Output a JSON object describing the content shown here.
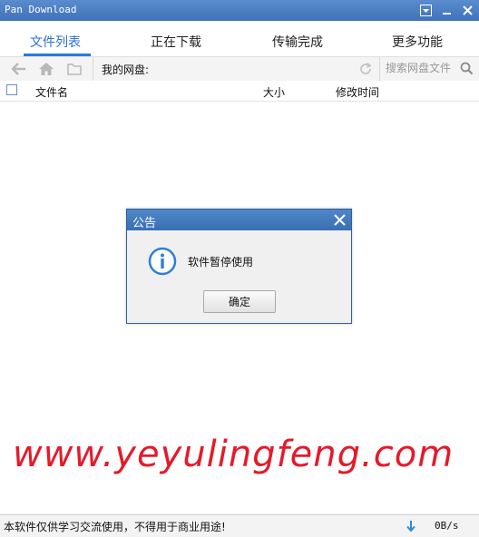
{
  "window": {
    "title": "Pan Download",
    "menu_icon": "dropdown-menu-icon",
    "minimize_icon": "minimize-icon",
    "close_icon": "close-icon"
  },
  "tabs": [
    {
      "label": "文件列表",
      "active": true
    },
    {
      "label": "正在下载",
      "active": false
    },
    {
      "label": "传输完成",
      "active": false
    },
    {
      "label": "更多功能",
      "active": false
    }
  ],
  "toolbar": {
    "back_icon": "back-arrow-icon",
    "home_icon": "home-icon",
    "folder_icon": "folder-icon",
    "path_label": "我的网盘:",
    "refresh_icon": "refresh-icon",
    "search_placeholder": "搜索网盘文件",
    "search_icon": "search-icon"
  },
  "table_header": {
    "name": "文件名",
    "size": "大小",
    "modified": "修改时间"
  },
  "dialog": {
    "title": "公告",
    "message": "软件暂停使用",
    "ok_label": "确定",
    "icon": "info-icon"
  },
  "watermark": "www.yeyulingfeng.com",
  "statusbar": {
    "notice": "本软件仅供学习交流使用，不得用于商业用途!",
    "speed": "0B/s"
  },
  "colors": {
    "accent": "#2a6fd2",
    "titlebar": "#4a7cc0",
    "watermark": "#e51a2a"
  }
}
